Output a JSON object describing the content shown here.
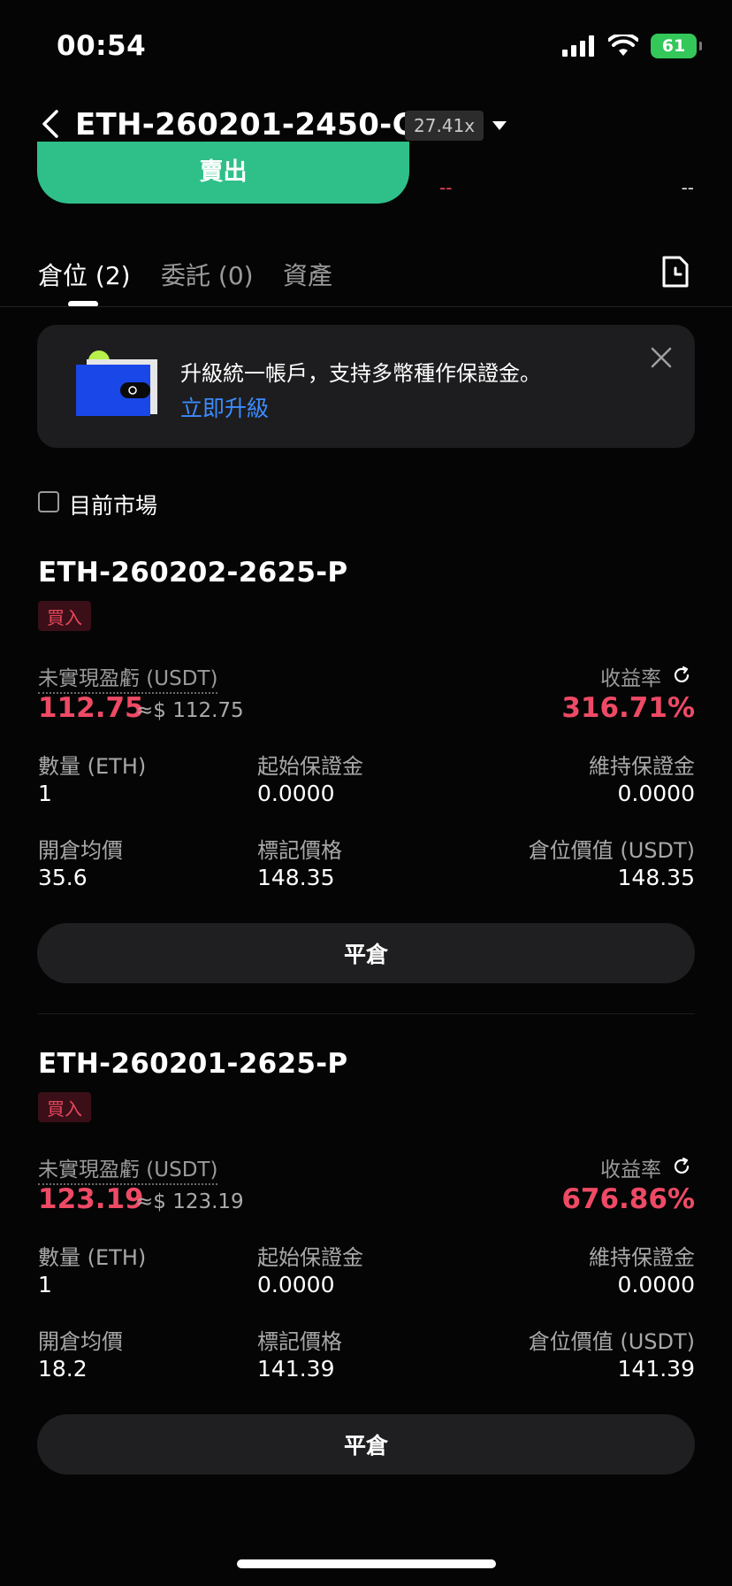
{
  "status_bar": {
    "time": "00:54",
    "battery": "61"
  },
  "header": {
    "title": "ETH-260201-2450-C",
    "leverage": "27.41x"
  },
  "trade_area": {
    "sell_label": "賣出",
    "orderbook_left": "--",
    "orderbook_right": "--"
  },
  "tabs": [
    {
      "label": "倉位 (2)"
    },
    {
      "label": "委託 (0)"
    },
    {
      "label": "資產"
    }
  ],
  "banner": {
    "text": "升級統一帳戶，支持多幣種作保證金。",
    "link": "立即升級"
  },
  "filter": {
    "current_market_label": "目前市場"
  },
  "positions": [
    {
      "symbol": "ETH-260202-2625-P",
      "side": "買入",
      "pnl_label": "未實現盈虧 (USDT)",
      "pnl_value": "112.75",
      "pnl_approx": "≈$ 112.75",
      "roi_label": "收益率",
      "roi_value": "316.71%",
      "qty_label": "數量 (ETH)",
      "qty_value": "1",
      "init_margin_label": "起始保證金",
      "init_margin_value": "0.0000",
      "maint_margin_label": "維持保證金",
      "maint_margin_value": "0.0000",
      "entry_label": "開倉均價",
      "entry_value": "35.6",
      "mark_label": "標記價格",
      "mark_value": "148.35",
      "pos_value_label": "倉位價值 (USDT)",
      "pos_value": "148.35",
      "close_label": "平倉"
    },
    {
      "symbol": "ETH-260201-2625-P",
      "side": "買入",
      "pnl_label": "未實現盈虧 (USDT)",
      "pnl_value": "123.19",
      "pnl_approx": "≈$ 123.19",
      "roi_label": "收益率",
      "roi_value": "676.86%",
      "qty_label": "數量 (ETH)",
      "qty_value": "1",
      "init_margin_label": "起始保證金",
      "init_margin_value": "0.0000",
      "maint_margin_label": "維持保證金",
      "maint_margin_value": "0.0000",
      "entry_label": "開倉均價",
      "entry_value": "18.2",
      "mark_label": "標記價格",
      "mark_value": "141.39",
      "pos_value_label": "倉位價值 (USDT)",
      "pos_value": "141.39",
      "close_label": "平倉"
    }
  ],
  "colors": {
    "accent_green": "#2fc08a",
    "loss_red": "#ee4a65",
    "link_blue": "#3c8cff",
    "background": "#050505"
  },
  "icons": [
    "back-chevron-icon",
    "dropdown-caret-icon",
    "history-document-icon",
    "close-icon",
    "wallet-illustration-icon",
    "refresh-icon",
    "signal-icon",
    "wifi-icon",
    "battery-icon"
  ]
}
